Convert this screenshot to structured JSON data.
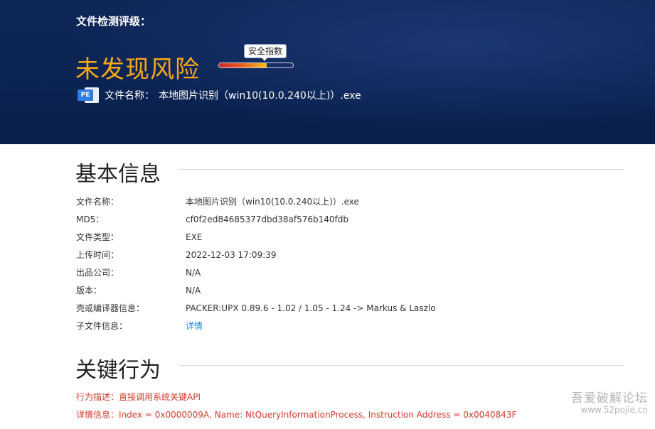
{
  "hero": {
    "level_label": "文件检测评级：",
    "verdict": "未发现风险",
    "safety_index_label": "安全指数",
    "safety_index_fraction": 0.64,
    "file_name_label": "文件名称：",
    "file_name": "本地图片识别（win10(10.0.240以上)）.exe",
    "pe_icon_text": "PE"
  },
  "basic_info": {
    "title": "基本信息",
    "rows": [
      {
        "label": "文件名称：",
        "value": "本地图片识别（win10(10.0.240以上)）.exe"
      },
      {
        "label": "MD5：",
        "value": "cf0f2ed84685377dbd38af576b140fdb"
      },
      {
        "label": "文件类型：",
        "value": "EXE"
      },
      {
        "label": "上传时间：",
        "value": "2022-12-03 17:09:39"
      },
      {
        "label": "出品公司：",
        "value": "N/A"
      },
      {
        "label": "版本：",
        "value": "N/A"
      },
      {
        "label": "壳或编译器信息：",
        "value": "PACKER:UPX 0.89.6 - 1.02 / 1.05 - 1.24 -> Markus & Laszlo"
      },
      {
        "label": "子文件信息：",
        "value": "详情"
      }
    ]
  },
  "key_behavior": {
    "title": "关键行为",
    "description": "行为描述：直接调用系统关键API",
    "detail": "详情信息：Index = 0x0000009A, Name: NtQueryInformationProcess, Instruction Address = 0x0040843F"
  },
  "watermark": {
    "line1": "吾爱破解论坛",
    "line2": "www.52pojie.cn"
  }
}
